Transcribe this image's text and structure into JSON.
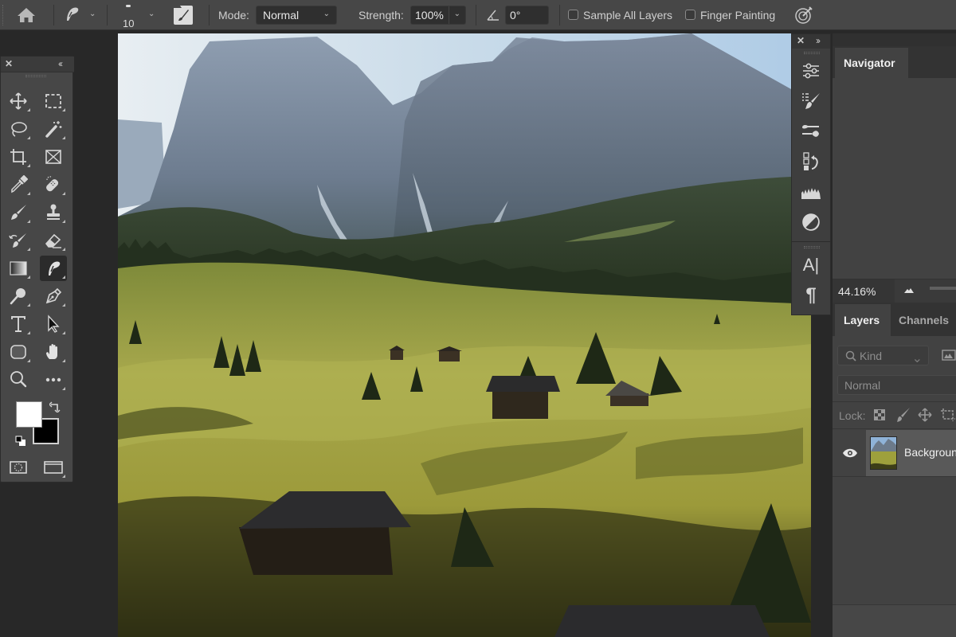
{
  "options_bar": {
    "home_icon": "home-icon",
    "tool_preset_icon": "smudge-tool-icon",
    "brush_size": "10",
    "brush_settings_icon": "brush-settings-icon",
    "mode_label": "Mode:",
    "mode_value": "Normal",
    "strength_label": "Strength:",
    "strength_value": "100%",
    "angle_icon": "angle-icon",
    "angle_value": "0°",
    "sample_all_layers_label": "Sample All Layers",
    "sample_all_layers_checked": false,
    "finger_painting_label": "Finger Painting",
    "finger_painting_checked": false,
    "pressure_icon": "pressure-strength-icon"
  },
  "tools_panel": {
    "close_glyph": "✕",
    "collapse_glyph": "‹‹",
    "tools": [
      {
        "name": "move-tool"
      },
      {
        "name": "marquee-tool"
      },
      {
        "name": "lasso-tool"
      },
      {
        "name": "magic-wand-tool"
      },
      {
        "name": "crop-tool"
      },
      {
        "name": "frame-tool"
      },
      {
        "name": "eyedropper-tool"
      },
      {
        "name": "healing-brush-tool"
      },
      {
        "name": "brush-tool"
      },
      {
        "name": "clone-stamp-tool"
      },
      {
        "name": "history-brush-tool"
      },
      {
        "name": "eraser-tool"
      },
      {
        "name": "gradient-tool"
      },
      {
        "name": "smudge-tool",
        "active": true
      },
      {
        "name": "dodge-tool"
      },
      {
        "name": "pen-tool"
      },
      {
        "name": "type-tool"
      },
      {
        "name": "path-selection-tool"
      },
      {
        "name": "shape-tool"
      },
      {
        "name": "hand-tool"
      },
      {
        "name": "zoom-tool"
      },
      {
        "name": "edit-toolbar"
      }
    ],
    "foreground_color": "#ffffff",
    "background_color": "#000000",
    "quick_mask_icon": "quick-mask-icon",
    "screen_mode_icon": "screen-mode-icon"
  },
  "dock": {
    "close_glyph": "✕",
    "expand_glyph": "››",
    "icons": [
      "adjustments-icon",
      "brushes-icon",
      "brush-settings-icon",
      "history-icon",
      "histogram-icon",
      "styles-icon",
      "character-icon",
      "paragraph-icon"
    ],
    "character_glyph": "A|",
    "paragraph_glyph": "¶"
  },
  "navigator": {
    "tab_label": "Navigator",
    "zoom_value": "44.16%"
  },
  "layers": {
    "tabs": [
      {
        "label": "Layers",
        "active": true
      },
      {
        "label": "Channels",
        "active": false
      }
    ],
    "filter_label": "Kind",
    "blend_mode": "Normal",
    "lock_label": "Lock:",
    "items": [
      {
        "name": "Background",
        "visible": true
      }
    ]
  }
}
